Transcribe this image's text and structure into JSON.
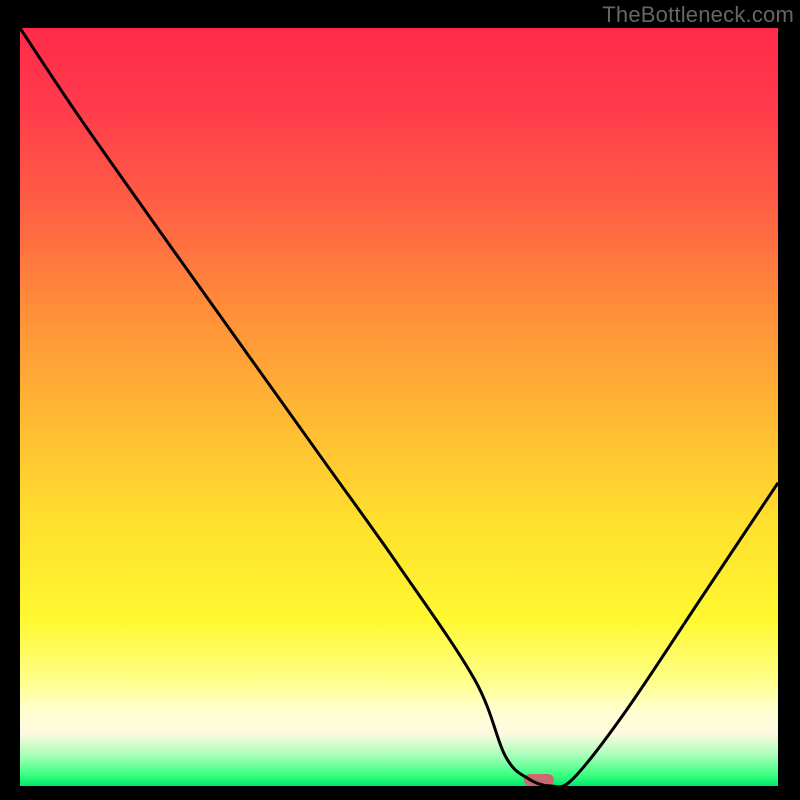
{
  "watermark": "TheBottleneck.com",
  "colors": {
    "gradient_top": "#ff2a4a",
    "gradient_mid": "#ffdf2e",
    "gradient_bottom": "#00e86a",
    "curve": "#000000",
    "marker": "#c96a70",
    "background": "#000000"
  },
  "chart_data": {
    "type": "line",
    "title": "",
    "xlabel": "",
    "ylabel": "",
    "xlim": [
      0,
      100
    ],
    "ylim": [
      0,
      100
    ],
    "grid": false,
    "legend": false,
    "series": [
      {
        "name": "curve",
        "x": [
          0,
          8,
          20,
          30,
          40,
          50,
          60,
          64,
          67,
          70,
          73,
          80,
          90,
          100
        ],
        "values": [
          100,
          88,
          71,
          57,
          43,
          29,
          14,
          4,
          1,
          0,
          1,
          10,
          25,
          40
        ]
      }
    ],
    "marker": {
      "x_percent": 68.5,
      "y_percent": 0,
      "width_percent": 4,
      "height_percent": 1.6
    },
    "annotations": []
  }
}
